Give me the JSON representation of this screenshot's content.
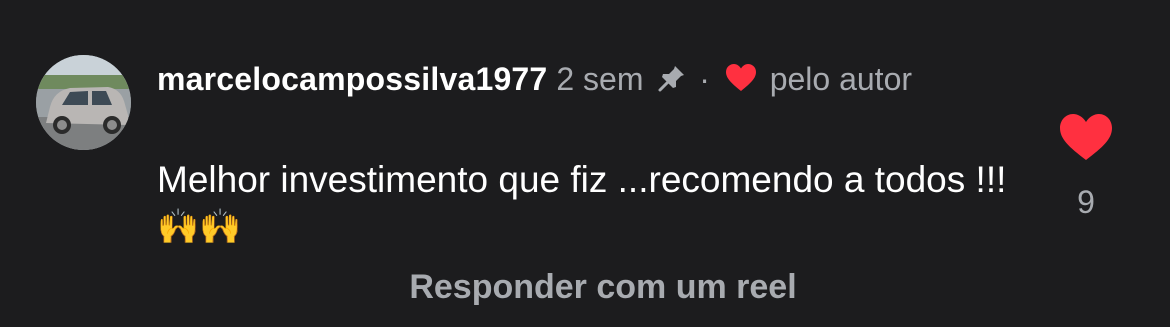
{
  "comment": {
    "username": "marcelocampossilva1977",
    "time_ago": "2 sem",
    "separator": "·",
    "liked_by_author_label": "pelo autor",
    "text": "Melhor investimento que fiz ...recomendo a todos !!!",
    "emoji": "🙌🙌",
    "like_count": "9",
    "reply_label": "Responder com um reel"
  },
  "icons": {
    "pin": "pin-icon",
    "author_heart": "heart-icon",
    "like": "heart-icon"
  },
  "colors": {
    "background": "#1c1c1e",
    "heart": "#ff3040",
    "text_secondary": "#a8abb0",
    "text_primary": "#ffffff"
  }
}
